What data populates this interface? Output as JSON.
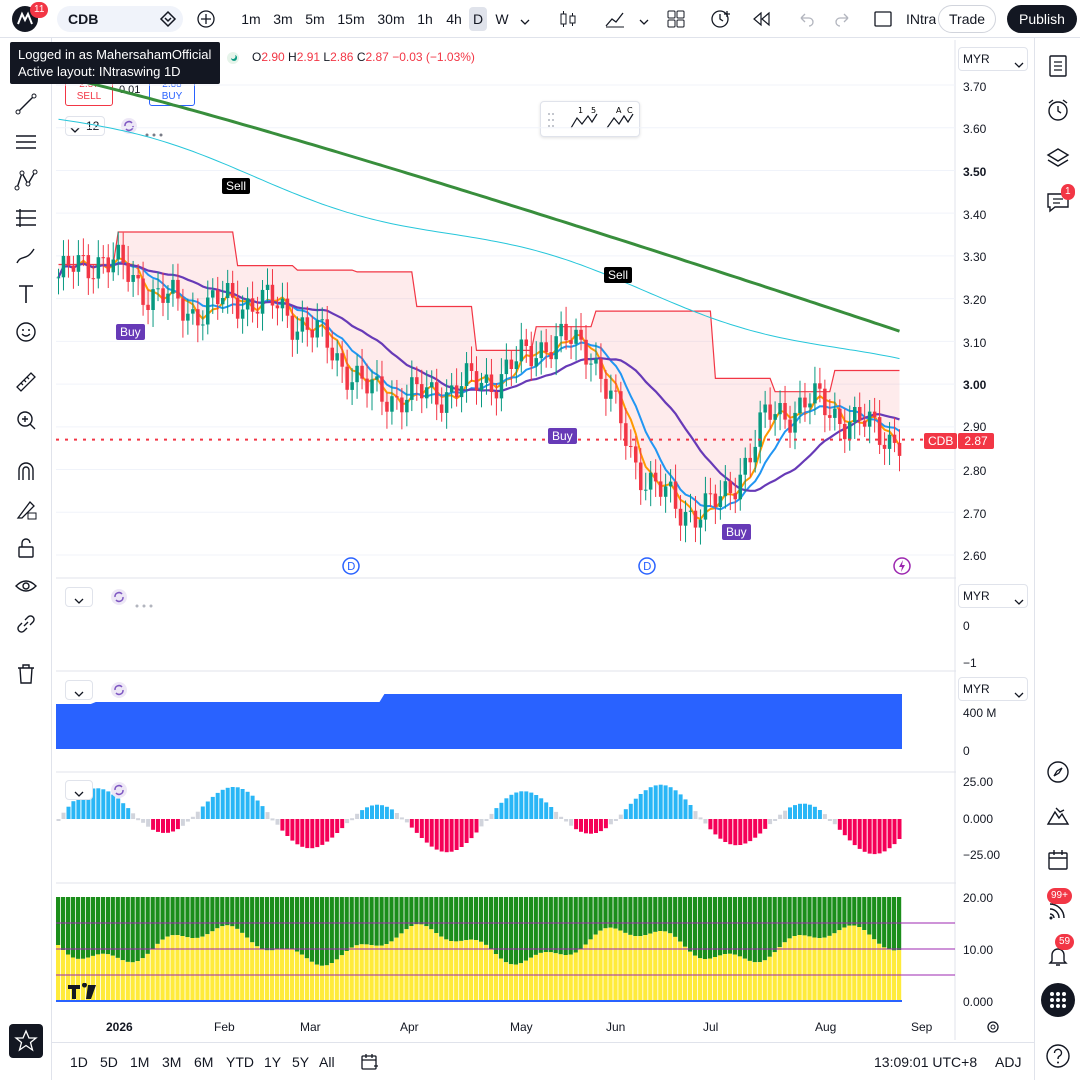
{
  "app": {
    "notifications": "11",
    "symbol": "CDB",
    "intervals": [
      "1m",
      "3m",
      "5m",
      "15m",
      "30m",
      "1h",
      "4h",
      "D",
      "W"
    ],
    "selected_interval": "D",
    "layout_name_short": "INtra",
    "trade_label": "Trade",
    "publish_label": "Publish"
  },
  "tooltip": {
    "line1": "Logged in as MahersahamOfficial",
    "line2": "Active layout: INtraswing 1D"
  },
  "ohlc": {
    "o_label": "O",
    "o": "2.90",
    "h_label": "H",
    "h": "2.91",
    "l_label": "L",
    "l": "2.86",
    "c_label": "C",
    "c": "2.87",
    "change": "−0.03 (−1.03%)"
  },
  "order_box": {
    "sell_price": "2.87",
    "sell_label": "SELL",
    "spread": "0.01",
    "buy_price": "2.88",
    "buy_label": "BUY"
  },
  "indicator_count": "12",
  "currency": "MYR",
  "price_axis": [
    "3.70",
    "3.60",
    "3.50",
    "3.40",
    "3.30",
    "3.20",
    "3.10",
    "3.00",
    "2.90",
    "2.80",
    "2.70",
    "2.60"
  ],
  "current_price": {
    "symbol": "CDB",
    "value": "2.87"
  },
  "pane2_axis": [
    "0",
    "−1"
  ],
  "pane3_axis": [
    "400 M",
    "0"
  ],
  "pane4_axis": [
    "25.00",
    "0.000",
    "−25.00"
  ],
  "pane5_axis": [
    "20.00",
    "10.00",
    "0.000"
  ],
  "signals": {
    "sell1": "Sell",
    "sell2": "Sell",
    "buy1": "Buy",
    "buy2": "Buy",
    "buy3": "Buy"
  },
  "time_axis": [
    "2026",
    "Feb",
    "Mar",
    "Apr",
    "May",
    "Jun",
    "Jul",
    "Aug",
    "Sep"
  ],
  "bottom": {
    "ranges": [
      "1D",
      "5D",
      "1M",
      "3M",
      "6M",
      "YTD",
      "1Y",
      "5Y",
      "All"
    ],
    "clock": "13:09:01 UTC+8",
    "adj": "ADJ"
  },
  "rightbar": {
    "chat_badge": "1",
    "feed_badge": "99+",
    "alerts_badge": "59"
  },
  "chart_data": {
    "type": "candlestick",
    "x": [
      "2026",
      "Feb",
      "Mar",
      "Apr",
      "May",
      "Jun",
      "Jul",
      "Aug",
      "Sep"
    ],
    "ylim": [
      2.6,
      3.7
    ],
    "series": [
      {
        "name": "",
        "values": [
          3.25,
          3.3,
          3.22,
          3.17,
          3.2,
          3.18,
          3.1,
          2.98,
          2.97,
          2.99,
          3.02,
          3.1,
          3.09,
          2.82,
          2.7,
          2.72,
          2.92,
          2.96,
          2.91,
          2.87
        ]
      }
    ]
  }
}
